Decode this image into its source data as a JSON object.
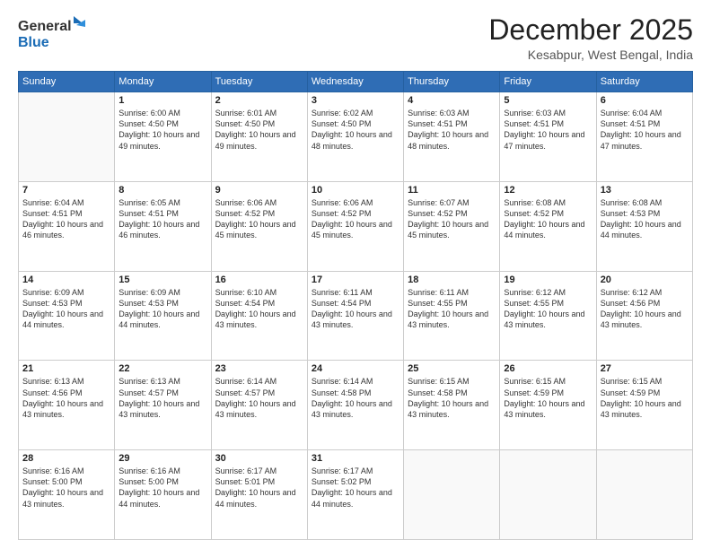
{
  "header": {
    "logo_line1": "General",
    "logo_line2": "Blue",
    "month": "December 2025",
    "location": "Kesabpur, West Bengal, India"
  },
  "weekdays": [
    "Sunday",
    "Monday",
    "Tuesday",
    "Wednesday",
    "Thursday",
    "Friday",
    "Saturday"
  ],
  "weeks": [
    [
      {
        "day": null
      },
      {
        "day": "1",
        "sunrise": "6:00 AM",
        "sunset": "4:50 PM",
        "daylight": "10 hours and 49 minutes."
      },
      {
        "day": "2",
        "sunrise": "6:01 AM",
        "sunset": "4:50 PM",
        "daylight": "10 hours and 49 minutes."
      },
      {
        "day": "3",
        "sunrise": "6:02 AM",
        "sunset": "4:50 PM",
        "daylight": "10 hours and 48 minutes."
      },
      {
        "day": "4",
        "sunrise": "6:03 AM",
        "sunset": "4:51 PM",
        "daylight": "10 hours and 48 minutes."
      },
      {
        "day": "5",
        "sunrise": "6:03 AM",
        "sunset": "4:51 PM",
        "daylight": "10 hours and 47 minutes."
      },
      {
        "day": "6",
        "sunrise": "6:04 AM",
        "sunset": "4:51 PM",
        "daylight": "10 hours and 47 minutes."
      }
    ],
    [
      {
        "day": "7",
        "sunrise": "6:04 AM",
        "sunset": "4:51 PM",
        "daylight": "10 hours and 46 minutes."
      },
      {
        "day": "8",
        "sunrise": "6:05 AM",
        "sunset": "4:51 PM",
        "daylight": "10 hours and 46 minutes."
      },
      {
        "day": "9",
        "sunrise": "6:06 AM",
        "sunset": "4:52 PM",
        "daylight": "10 hours and 45 minutes."
      },
      {
        "day": "10",
        "sunrise": "6:06 AM",
        "sunset": "4:52 PM",
        "daylight": "10 hours and 45 minutes."
      },
      {
        "day": "11",
        "sunrise": "6:07 AM",
        "sunset": "4:52 PM",
        "daylight": "10 hours and 45 minutes."
      },
      {
        "day": "12",
        "sunrise": "6:08 AM",
        "sunset": "4:52 PM",
        "daylight": "10 hours and 44 minutes."
      },
      {
        "day": "13",
        "sunrise": "6:08 AM",
        "sunset": "4:53 PM",
        "daylight": "10 hours and 44 minutes."
      }
    ],
    [
      {
        "day": "14",
        "sunrise": "6:09 AM",
        "sunset": "4:53 PM",
        "daylight": "10 hours and 44 minutes."
      },
      {
        "day": "15",
        "sunrise": "6:09 AM",
        "sunset": "4:53 PM",
        "daylight": "10 hours and 44 minutes."
      },
      {
        "day": "16",
        "sunrise": "6:10 AM",
        "sunset": "4:54 PM",
        "daylight": "10 hours and 43 minutes."
      },
      {
        "day": "17",
        "sunrise": "6:11 AM",
        "sunset": "4:54 PM",
        "daylight": "10 hours and 43 minutes."
      },
      {
        "day": "18",
        "sunrise": "6:11 AM",
        "sunset": "4:55 PM",
        "daylight": "10 hours and 43 minutes."
      },
      {
        "day": "19",
        "sunrise": "6:12 AM",
        "sunset": "4:55 PM",
        "daylight": "10 hours and 43 minutes."
      },
      {
        "day": "20",
        "sunrise": "6:12 AM",
        "sunset": "4:56 PM",
        "daylight": "10 hours and 43 minutes."
      }
    ],
    [
      {
        "day": "21",
        "sunrise": "6:13 AM",
        "sunset": "4:56 PM",
        "daylight": "10 hours and 43 minutes."
      },
      {
        "day": "22",
        "sunrise": "6:13 AM",
        "sunset": "4:57 PM",
        "daylight": "10 hours and 43 minutes."
      },
      {
        "day": "23",
        "sunrise": "6:14 AM",
        "sunset": "4:57 PM",
        "daylight": "10 hours and 43 minutes."
      },
      {
        "day": "24",
        "sunrise": "6:14 AM",
        "sunset": "4:58 PM",
        "daylight": "10 hours and 43 minutes."
      },
      {
        "day": "25",
        "sunrise": "6:15 AM",
        "sunset": "4:58 PM",
        "daylight": "10 hours and 43 minutes."
      },
      {
        "day": "26",
        "sunrise": "6:15 AM",
        "sunset": "4:59 PM",
        "daylight": "10 hours and 43 minutes."
      },
      {
        "day": "27",
        "sunrise": "6:15 AM",
        "sunset": "4:59 PM",
        "daylight": "10 hours and 43 minutes."
      }
    ],
    [
      {
        "day": "28",
        "sunrise": "6:16 AM",
        "sunset": "5:00 PM",
        "daylight": "10 hours and 43 minutes."
      },
      {
        "day": "29",
        "sunrise": "6:16 AM",
        "sunset": "5:00 PM",
        "daylight": "10 hours and 44 minutes."
      },
      {
        "day": "30",
        "sunrise": "6:17 AM",
        "sunset": "5:01 PM",
        "daylight": "10 hours and 44 minutes."
      },
      {
        "day": "31",
        "sunrise": "6:17 AM",
        "sunset": "5:02 PM",
        "daylight": "10 hours and 44 minutes."
      },
      {
        "day": null
      },
      {
        "day": null
      },
      {
        "day": null
      }
    ]
  ],
  "labels": {
    "sunrise": "Sunrise:",
    "sunset": "Sunset:",
    "daylight": "Daylight:"
  }
}
